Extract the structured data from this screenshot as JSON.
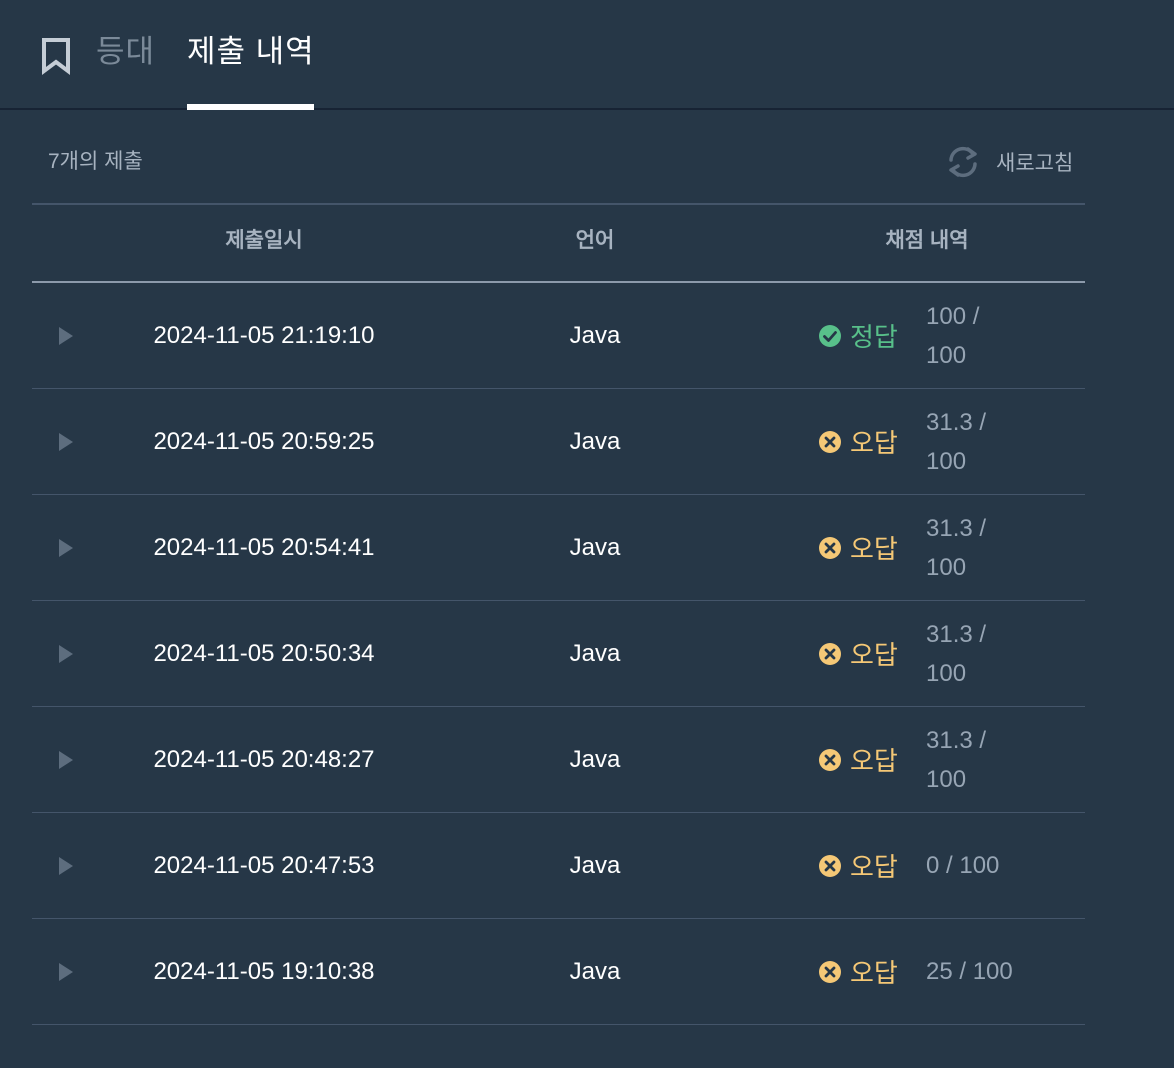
{
  "header": {
    "bookmark_icon": "bookmark-icon",
    "tab_inactive": "등대",
    "tab_active": "제출 내역"
  },
  "toolbar": {
    "count_label": "7개의 제출",
    "refresh_label": "새로고침",
    "refresh_icon": "refresh-icon"
  },
  "table": {
    "columns": [
      "제출일시",
      "언어",
      "채점 내역"
    ],
    "rows": [
      {
        "datetime": "2024-11-05 21:19:10",
        "language": "Java",
        "status": "정답",
        "result": "pass",
        "score": "100 / 100"
      },
      {
        "datetime": "2024-11-05 20:59:25",
        "language": "Java",
        "status": "오답",
        "result": "fail",
        "score": "31.3 / 100"
      },
      {
        "datetime": "2024-11-05 20:54:41",
        "language": "Java",
        "status": "오답",
        "result": "fail",
        "score": "31.3 / 100"
      },
      {
        "datetime": "2024-11-05 20:50:34",
        "language": "Java",
        "status": "오답",
        "result": "fail",
        "score": "31.3 / 100"
      },
      {
        "datetime": "2024-11-05 20:48:27",
        "language": "Java",
        "status": "오답",
        "result": "fail",
        "score": "31.3 / 100"
      },
      {
        "datetime": "2024-11-05 20:47:53",
        "language": "Java",
        "status": "오답",
        "result": "fail",
        "score": "0 / 100"
      },
      {
        "datetime": "2024-11-05 19:10:38",
        "language": "Java",
        "status": "오답",
        "result": "fail",
        "score": "25 / 100"
      }
    ]
  },
  "colors": {
    "background": "#263747",
    "pass": "#58c08a",
    "fail": "#f5c876",
    "muted": "#a7b3c0"
  }
}
